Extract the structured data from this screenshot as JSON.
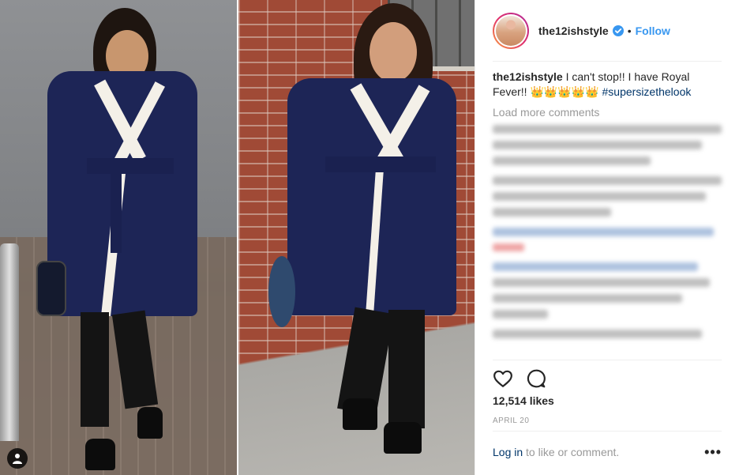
{
  "post": {
    "username": "the12ishstyle",
    "follow_label": "Follow",
    "separator": "•",
    "caption_text": " I can't stop!! I have Royal Fever!! 👑👑👑👑👑 ",
    "hashtag": "#supersizethelook",
    "load_more": "Load more comments",
    "likes": "12,514 likes",
    "date": "APRIL 20",
    "login_link": "Log in",
    "login_suffix": " to like or comment.",
    "more_options": "•••"
  },
  "icons": {
    "verified": "verified-badge-icon",
    "like": "heart-icon",
    "comment": "comment-bubble-icon",
    "user_tag": "person-icon",
    "more": "ellipsis-icon"
  },
  "colors": {
    "link_blue": "#3897f0",
    "hashtag_blue": "#003569",
    "muted": "#999999",
    "coat_navy": "#1d2556"
  }
}
